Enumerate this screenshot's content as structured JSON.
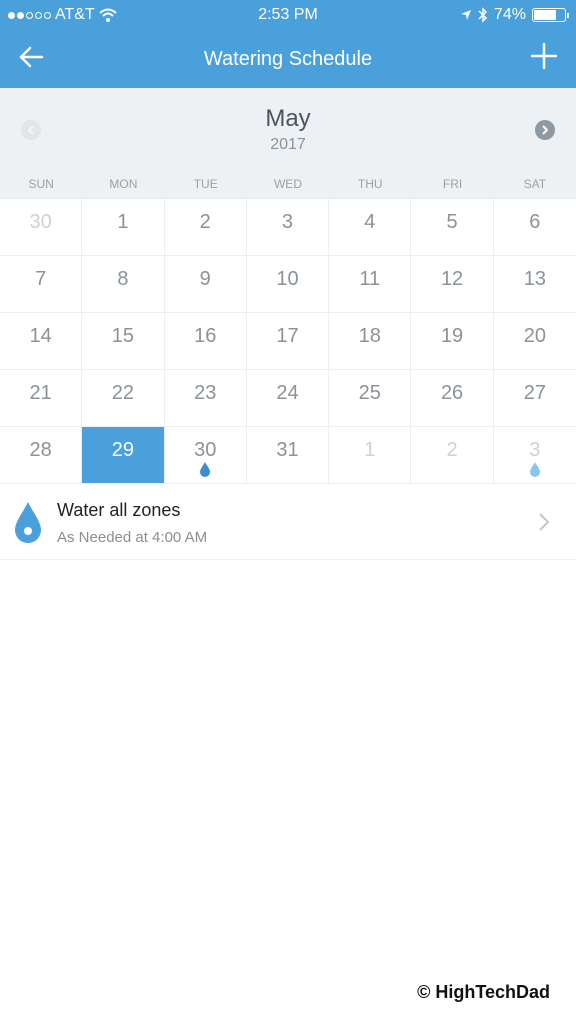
{
  "status_bar": {
    "carrier": "AT&T",
    "signal_bars_filled": 2,
    "signal_bars_total": 5,
    "time": "2:53 PM",
    "battery": "74%",
    "battery_level": 0.74
  },
  "nav": {
    "title": "Watering Schedule",
    "back_icon": "arrow-left-icon",
    "add_icon": "plus-icon"
  },
  "calendar": {
    "month": "May",
    "year": "2017",
    "weekdays": [
      "SUN",
      "MON",
      "TUE",
      "WED",
      "THU",
      "FRI",
      "SAT"
    ],
    "weeks": [
      [
        {
          "d": "30",
          "muted": true
        },
        {
          "d": "1"
        },
        {
          "d": "2"
        },
        {
          "d": "3"
        },
        {
          "d": "4"
        },
        {
          "d": "5"
        },
        {
          "d": "6"
        }
      ],
      [
        {
          "d": "7"
        },
        {
          "d": "8"
        },
        {
          "d": "9"
        },
        {
          "d": "10"
        },
        {
          "d": "11"
        },
        {
          "d": "12"
        },
        {
          "d": "13"
        }
      ],
      [
        {
          "d": "14"
        },
        {
          "d": "15"
        },
        {
          "d": "16"
        },
        {
          "d": "17"
        },
        {
          "d": "18"
        },
        {
          "d": "19"
        },
        {
          "d": "20"
        }
      ],
      [
        {
          "d": "21"
        },
        {
          "d": "22"
        },
        {
          "d": "23"
        },
        {
          "d": "24"
        },
        {
          "d": "25"
        },
        {
          "d": "26"
        },
        {
          "d": "27"
        }
      ],
      [
        {
          "d": "28"
        },
        {
          "d": "29",
          "selected": true
        },
        {
          "d": "30",
          "drop": "#3a8fd0"
        },
        {
          "d": "31"
        },
        {
          "d": "1",
          "muted": true
        },
        {
          "d": "2",
          "muted": true
        },
        {
          "d": "3",
          "muted": true,
          "drop": "#8cc5ea"
        }
      ]
    ]
  },
  "schedule": [
    {
      "title": "Water all zones",
      "subtitle": "As Needed at 4:00 AM"
    }
  ],
  "watermark": "© HighTechDad",
  "colors": {
    "accent": "#4aa0db"
  }
}
